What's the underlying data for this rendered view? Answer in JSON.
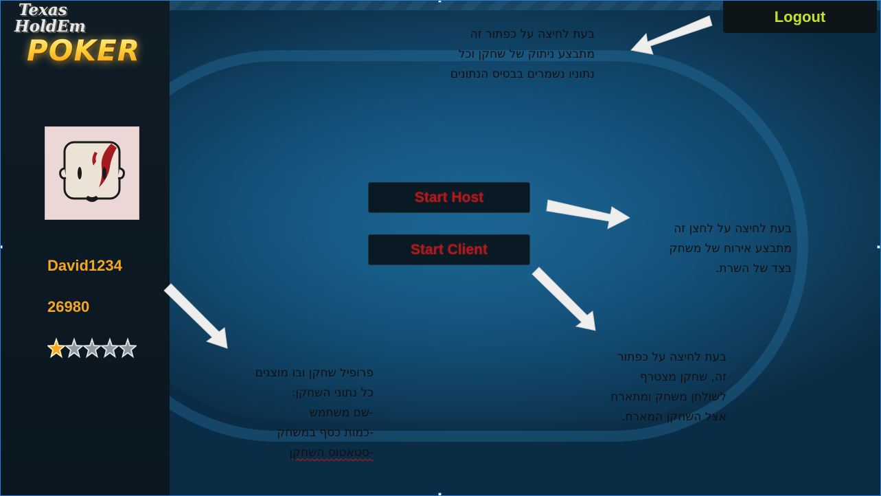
{
  "logo": {
    "line1": "Texas",
    "line2": "HoldEm",
    "line3": "POKER"
  },
  "player": {
    "username": "David1234",
    "money": "26980",
    "rating": 1,
    "rating_max": 5,
    "avatar_icon": "bald-face-avatar-icon"
  },
  "header": {
    "logout_label": "Logout"
  },
  "buttons": {
    "start_host_label": "Start Host",
    "start_client_label": "Start Client"
  },
  "notes": {
    "logout": [
      "בעת לחיצה על כפתור זה",
      "מתבצע ניתוק של שחקן וכל",
      "נתוניו נשמרים בבסיס הנתונים"
    ],
    "host": [
      "בעת לחיצה על לחצן זה",
      "מתבצע אירוח של משחק",
      "בצד של השרת."
    ],
    "client": [
      "בעת לחיצה על כפתור",
      "זה, שחקן מצטרף",
      "לשולחן משחק ומתארח",
      "אצל  השחקן המארח."
    ],
    "profile": [
      "פרופיל שחקן ובו מוצגים",
      "כל נתוני השחקן:",
      "-שם משתמש",
      "-כמות כסף במשחק",
      "-סטאטוס השחקן"
    ]
  },
  "colors": {
    "accent_gold": "#f5a623",
    "logout_text": "#c8e02a",
    "button_text_red": "#b2191d",
    "felt_blue": "#15557f",
    "sidebar_dark": "#0f1c26"
  }
}
